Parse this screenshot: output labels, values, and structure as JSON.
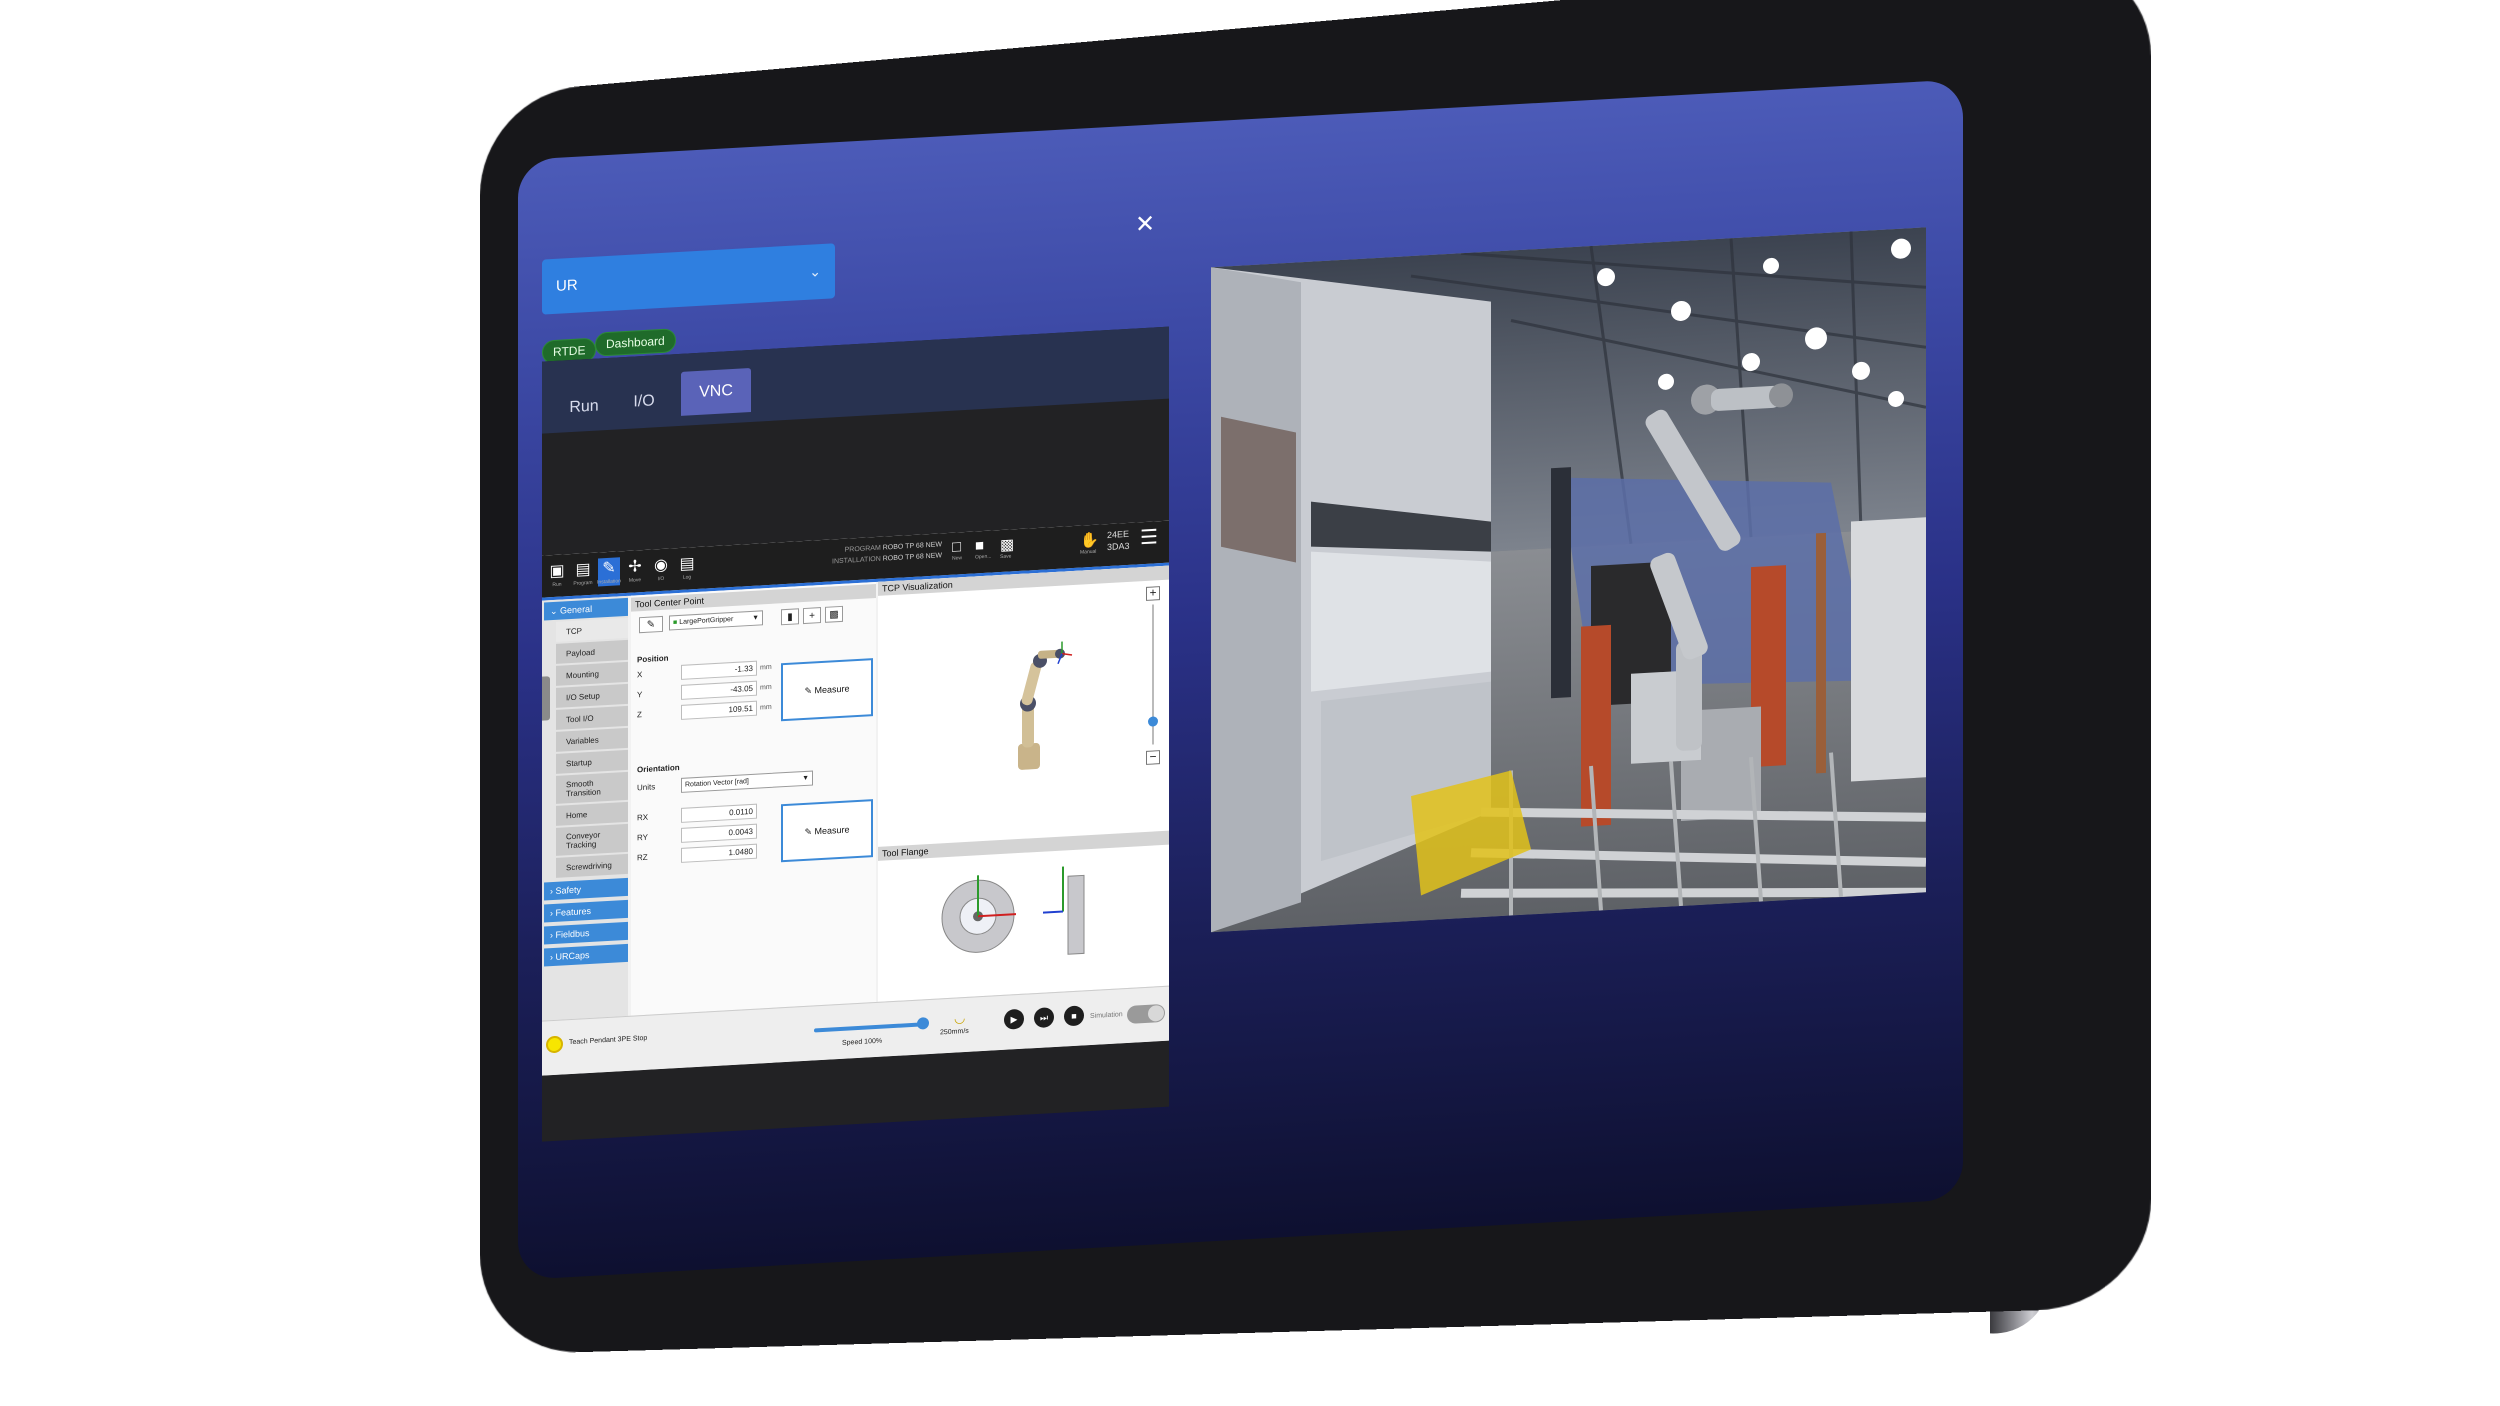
{
  "device_selector": {
    "value": "UR"
  },
  "close_icon": "close-icon",
  "tags": [
    "RTDE",
    "Dashboard"
  ],
  "tabs": [
    "Run",
    "I/O",
    "VNC"
  ],
  "active_tab": "VNC",
  "polyscope": {
    "program_label": "PROGRAM",
    "program_value": "ROBO TP 68 NEW",
    "installation_label": "INSTALLATION",
    "installation_value": "ROBO TP 68 NEW",
    "header_icons": [
      "ur-logo-icon",
      "program-icon",
      "installation-icon",
      "move-icon",
      "io-icon",
      "log-icon"
    ],
    "header_icon_labels": [
      "Run",
      "Program",
      "Installation",
      "Move",
      "I/O",
      "Log"
    ],
    "file_buttons": [
      "New",
      "Open...",
      "Save"
    ],
    "mode": "Manual",
    "robot_id_line1": "24EE",
    "robot_id_line2": "3DA3",
    "sidebar": {
      "general": "General",
      "items": [
        "TCP",
        "Payload",
        "Mounting",
        "I/O Setup",
        "Tool I/O",
        "Variables",
        "Startup",
        "Smooth Transition",
        "Home",
        "Conveyor Tracking",
        "Screwdriving"
      ],
      "groups": [
        "Safety",
        "Features",
        "Fieldbus",
        "URCaps"
      ]
    },
    "tcp": {
      "title": "Tool Center Point",
      "tcp_name": "LargePortGripper",
      "position_label": "Position",
      "x_label": "X",
      "x": "-1.33",
      "y_label": "Y",
      "y": "-43.05",
      "z_label": "Z",
      "z": "109.51",
      "unit": "mm",
      "measure_label": "Measure",
      "orientation_label": "Orientation",
      "units_label": "Units",
      "units_value": "Rotation Vector [rad]",
      "rx_label": "RX",
      "rx": "0.0110",
      "ry_label": "RY",
      "ry": "0.0043",
      "rz_label": "RZ",
      "rz": "1.0480"
    },
    "visualization_title": "TCP Visualization",
    "flange_title": "Tool Flange",
    "status_text": "Teach Pendant 3PE Stop",
    "speed_label": "Speed 100%",
    "speed_value": 1.0,
    "tcp_speed": "250mm/s",
    "simulation_label": "Simulation"
  },
  "camera_feed": "Factory floor with a robot arm next to a press brake"
}
